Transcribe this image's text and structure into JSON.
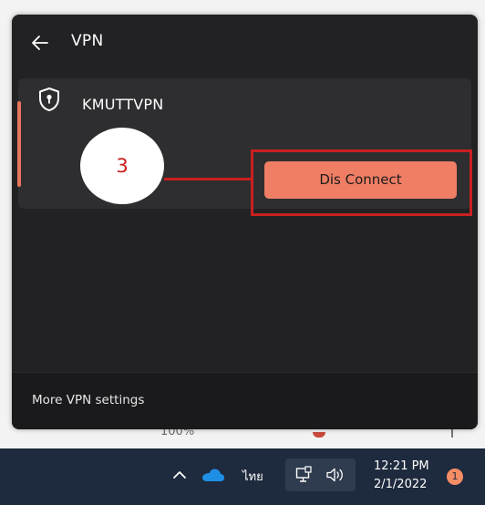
{
  "background": {
    "partial_text": "100%"
  },
  "flyout": {
    "title": "VPN",
    "back_icon": "arrow-left-icon",
    "vpn": {
      "icon": "shield-keyhole-icon",
      "name": "KMUTTVPN",
      "button_label": "Dis Connect"
    },
    "footer_link": "More VPN settings"
  },
  "annotation": {
    "step_number": "3"
  },
  "taskbar": {
    "language": "ไทย",
    "time": "12:21 PM",
    "date": "2/1/2022",
    "notification_count": "1"
  },
  "colors": {
    "accent": "#ef7e64",
    "annotation_red": "#c82020",
    "flyout_bg": "#222224",
    "taskbar_bg": "#1e2a3d"
  }
}
